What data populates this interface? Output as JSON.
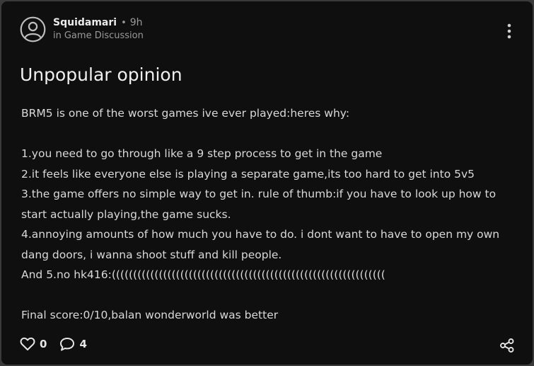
{
  "post": {
    "author": "Squidamari",
    "separator": "•",
    "time_ago": "9h",
    "community_prefix": "in",
    "community": "Game Discussion",
    "title": "Unpopular opinion",
    "body_lines": [
      "BRM5 is one of the worst games ive ever played:heres why:",
      "",
      "1.you need to go through like a 9 step process to get in the game",
      "2.it feels like everyone else is playing a separate game,its too hard to get into 5v5",
      "3.the game offers no simple way to get in. rule of thumb:if you have to look up how to",
      "start actually playing,the game sucks.",
      "4.annoying amounts of how much you have to do. i dont want to have to open my own",
      "dang doors, i wanna shoot stuff and kill people.",
      "And 5.no hk416:((((((((((((((((((((((((((((((((((((((((((((((((((((((((((((((((",
      "",
      "Final score:0/10,balan wonderworld was better"
    ],
    "likes": "0",
    "comments": "4"
  },
  "icons": {
    "avatar": "user-circle-icon",
    "more": "vertical-ellipsis-icon",
    "like": "heart-outline-icon",
    "comment": "speech-bubble-icon",
    "share": "share-nodes-icon"
  }
}
